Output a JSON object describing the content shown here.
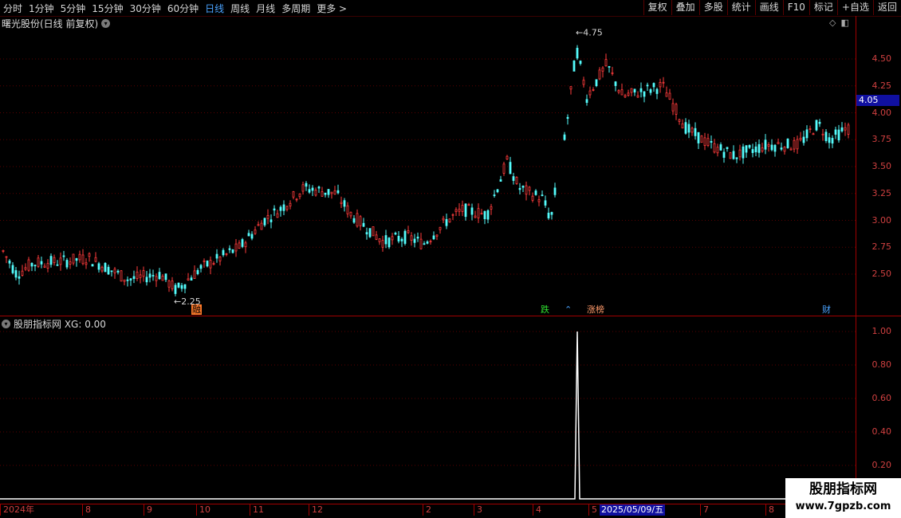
{
  "toolbar": {
    "periods": [
      "分时",
      "1分钟",
      "5分钟",
      "15分钟",
      "30分钟",
      "60分钟",
      "日线",
      "周线",
      "月线",
      "多周期",
      "更多 >"
    ],
    "active_period": "日线",
    "right_buttons": [
      "复权",
      "叠加",
      "多股",
      "统计",
      "画线",
      "F10",
      "+自选",
      "返回"
    ],
    "extra_button": "标记"
  },
  "stock": {
    "title": "曙光股份(日线 前复权)",
    "current_price_tag": "4.05",
    "high_label": "4.75",
    "low_label": "2.25"
  },
  "price_axis": {
    "ticks": [
      "4.50",
      "4.25",
      "4.00",
      "3.75",
      "3.50",
      "3.25",
      "3.00",
      "2.75",
      "2.50"
    ]
  },
  "events": {
    "e1": "融",
    "e2": "跌",
    "e3": "涨榜",
    "e4": "财"
  },
  "indicator": {
    "title": "股朋指标网 XG: 0.00",
    "ticks": [
      "1.00",
      "0.80",
      "0.60",
      "0.40",
      "0.20"
    ]
  },
  "date_axis": {
    "labels": [
      "2024年",
      "8",
      "9",
      "10",
      "11",
      "12",
      "2",
      "3",
      "4",
      "5",
      "7",
      "8"
    ],
    "highlight": "2025/05/09/五"
  },
  "watermark": {
    "line1": "股朋指标网",
    "line2": "www.7gpzb.com"
  },
  "chart_data": {
    "type": "candlestick",
    "price_range": [
      2.25,
      4.75
    ],
    "y_ticks": [
      2.5,
      2.75,
      3.0,
      3.25,
      3.5,
      3.75,
      4.0,
      4.25,
      4.5
    ],
    "annotated_high": 4.75,
    "annotated_low": 2.25,
    "last_price": 4.05,
    "indicator_series": {
      "name": "XG",
      "range": [
        0,
        1
      ],
      "spike_value": 1.0,
      "current_value": 0.0
    },
    "up_color": "#ff3b3b",
    "down_color": "#54fcfc"
  }
}
